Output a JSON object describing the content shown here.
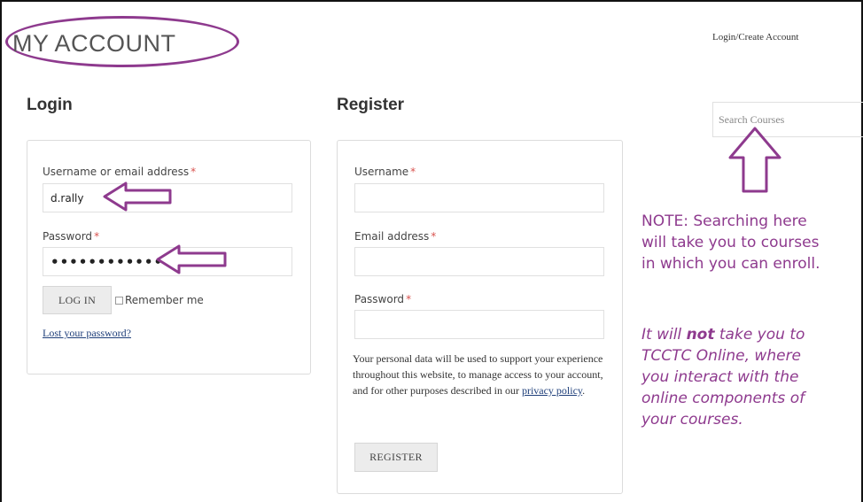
{
  "page": {
    "title": "MY ACCOUNT"
  },
  "header": {
    "account_link": "Login/Create Account"
  },
  "search": {
    "placeholder": "Search Courses"
  },
  "login": {
    "heading": "Login",
    "username_label": "Username or email address",
    "username_value": "d.rally",
    "password_label": "Password",
    "password_value": "••••••••••••",
    "required_marker": "*",
    "login_button": "LOG IN",
    "remember_label": "Remember me",
    "lost_password": "Lost your password?"
  },
  "register": {
    "heading": "Register",
    "username_label": "Username",
    "email_label": "Email address",
    "password_label": "Password",
    "required_marker": "*",
    "privacy_text_before": "Your personal data will be used to support your experience throughout this website, to manage access to your account, and for other purposes described in our ",
    "privacy_link": "privacy policy",
    "privacy_text_after": ".",
    "register_button": "REGISTER"
  },
  "annotation": {
    "color": "#8e3a8e",
    "note_line1": "NOTE: Searching here",
    "note_line2": "will take you to courses",
    "note_line3": "in which you can enroll.",
    "italic_line1_a": "It will ",
    "italic_line1_b": "not",
    "italic_line1_c": " take you to",
    "italic_line2": "TCCTC Online, where",
    "italic_line3": "you interact with the",
    "italic_line4": "online components of",
    "italic_line5": "your courses."
  }
}
